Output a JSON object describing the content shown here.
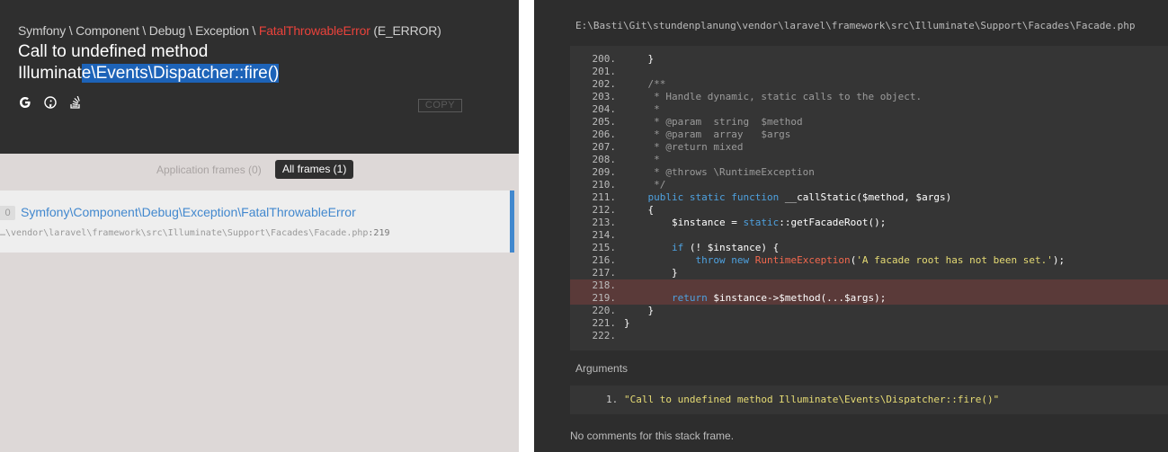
{
  "header": {
    "path_prefix": "Symfony \\ Component \\ Debug \\ Exception \\ ",
    "exception_class": "FatalThrowableError",
    "error_type": " (E_ERROR)",
    "message_part1": "Call to undefined method",
    "message_part2_plain": "Illuminat",
    "message_part2_selected": "e\\Events\\Dispatcher::fire()",
    "icons": [
      "google-icon",
      "duckduckgo-icon",
      "stackoverflow-icon"
    ],
    "copy_label": "COPY"
  },
  "frame_tabs": {
    "application_frames": "Application frames (0)",
    "all_frames": "All frames (1)"
  },
  "frame": {
    "index": "0",
    "class": "Symfony\\Component\\Debug\\Exception\\FatalThrowableError",
    "file": "…\\vendor\\laravel\\framework\\src\\Illuminate\\Support\\Facades\\Facade.php",
    "line": ":219"
  },
  "editor": {
    "file_path": "E:\\Basti\\Git\\stundenplanung\\vendor\\laravel\\framework\\src\\Illuminate\\Support\\Facades\\Facade.php",
    "highlighted_line": "219",
    "lines": [
      {
        "n": "200.",
        "html": "    }"
      },
      {
        "n": "201.",
        "html": ""
      },
      {
        "n": "202.",
        "html": "    <span class=\"c\">/**</span>"
      },
      {
        "n": "203.",
        "html": "<span class=\"c\">     * Handle dynamic, static calls to the object.</span>"
      },
      {
        "n": "204.",
        "html": "<span class=\"c\">     *</span>"
      },
      {
        "n": "205.",
        "html": "<span class=\"c\">     * @param  string  $method</span>"
      },
      {
        "n": "206.",
        "html": "<span class=\"c\">     * @param  array   $args</span>"
      },
      {
        "n": "207.",
        "html": "<span class=\"c\">     * @return mixed</span>"
      },
      {
        "n": "208.",
        "html": "<span class=\"c\">     *</span>"
      },
      {
        "n": "209.",
        "html": "<span class=\"c\">     * @throws \\RuntimeException</span>"
      },
      {
        "n": "210.",
        "html": "<span class=\"c\">     */</span>"
      },
      {
        "n": "211.",
        "html": "    <span class=\"k\">public static function</span> __callStatic($method, $args)"
      },
      {
        "n": "212.",
        "html": "    {"
      },
      {
        "n": "213.",
        "html": "        $instance = <span class=\"k\">static</span>::getFacadeRoot();"
      },
      {
        "n": "214.",
        "html": ""
      },
      {
        "n": "215.",
        "html": "        <span class=\"k\">if</span> (! $instance) {"
      },
      {
        "n": "216.",
        "html": "            <span class=\"k\">throw new</span> <span class=\"e\">RuntimeException</span>(<span class=\"s\">'A facade root has not been set.'</span>);"
      },
      {
        "n": "217.",
        "html": "        }"
      },
      {
        "n": "218.",
        "html": ""
      },
      {
        "n": "219.",
        "html": "        <span class=\"k\">return</span> $instance->$method(...$args);"
      },
      {
        "n": "220.",
        "html": "    }"
      },
      {
        "n": "221.",
        "html": "}"
      },
      {
        "n": "222.",
        "html": ""
      }
    ]
  },
  "arguments": {
    "label": "Arguments",
    "items": [
      {
        "num": "1.",
        "value": "\"Call to undefined method Illuminate\\Events\\Dispatcher::fire()\""
      }
    ]
  },
  "comments": {
    "none_text": "No comments for this stack frame."
  },
  "colors": {
    "exception_red": "#e9423b",
    "selection_blue": "#1d63b8",
    "link_blue": "#4288ce",
    "highlight_line": "#5a3a39"
  }
}
